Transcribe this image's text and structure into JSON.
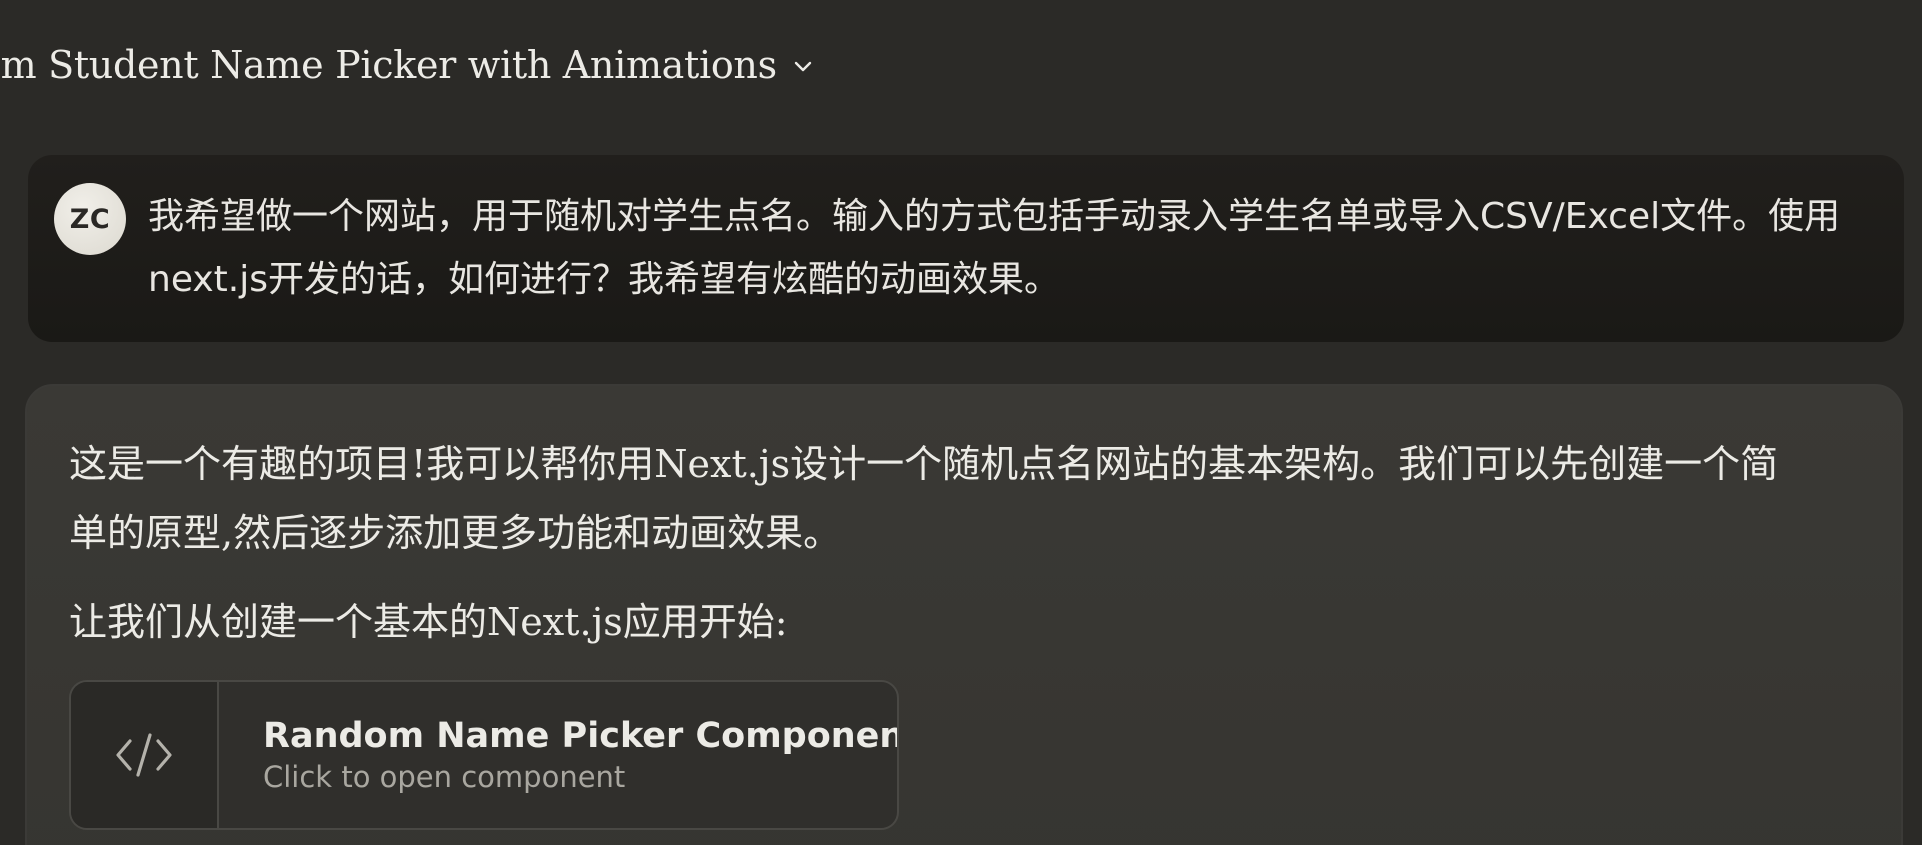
{
  "header": {
    "title": "om Student Name Picker with Animations",
    "dropdown_icon": "chevron-down-icon"
  },
  "user_message": {
    "avatar_initials": "ZC",
    "text": "我希望做一个网站，用于随机对学生点名。输入的方式包括手动录入学生名单或导入CSV/Excel文件。使用next.js开发的话，如何进行？我希望有炫酷的动画效果。"
  },
  "assistant_message": {
    "paragraphs": [
      "这是一个有趣的项目!我可以帮你用Next.js设计一个随机点名网站的基本架构。我们可以先创建一个简单的原型,然后逐步添加更多功能和动画效果。",
      "让我们从创建一个基本的Next.js应用开始:"
    ],
    "artifact": {
      "icon": "code-icon",
      "title": "Random Name Picker Component",
      "subtitle": "Click to open component"
    }
  }
}
